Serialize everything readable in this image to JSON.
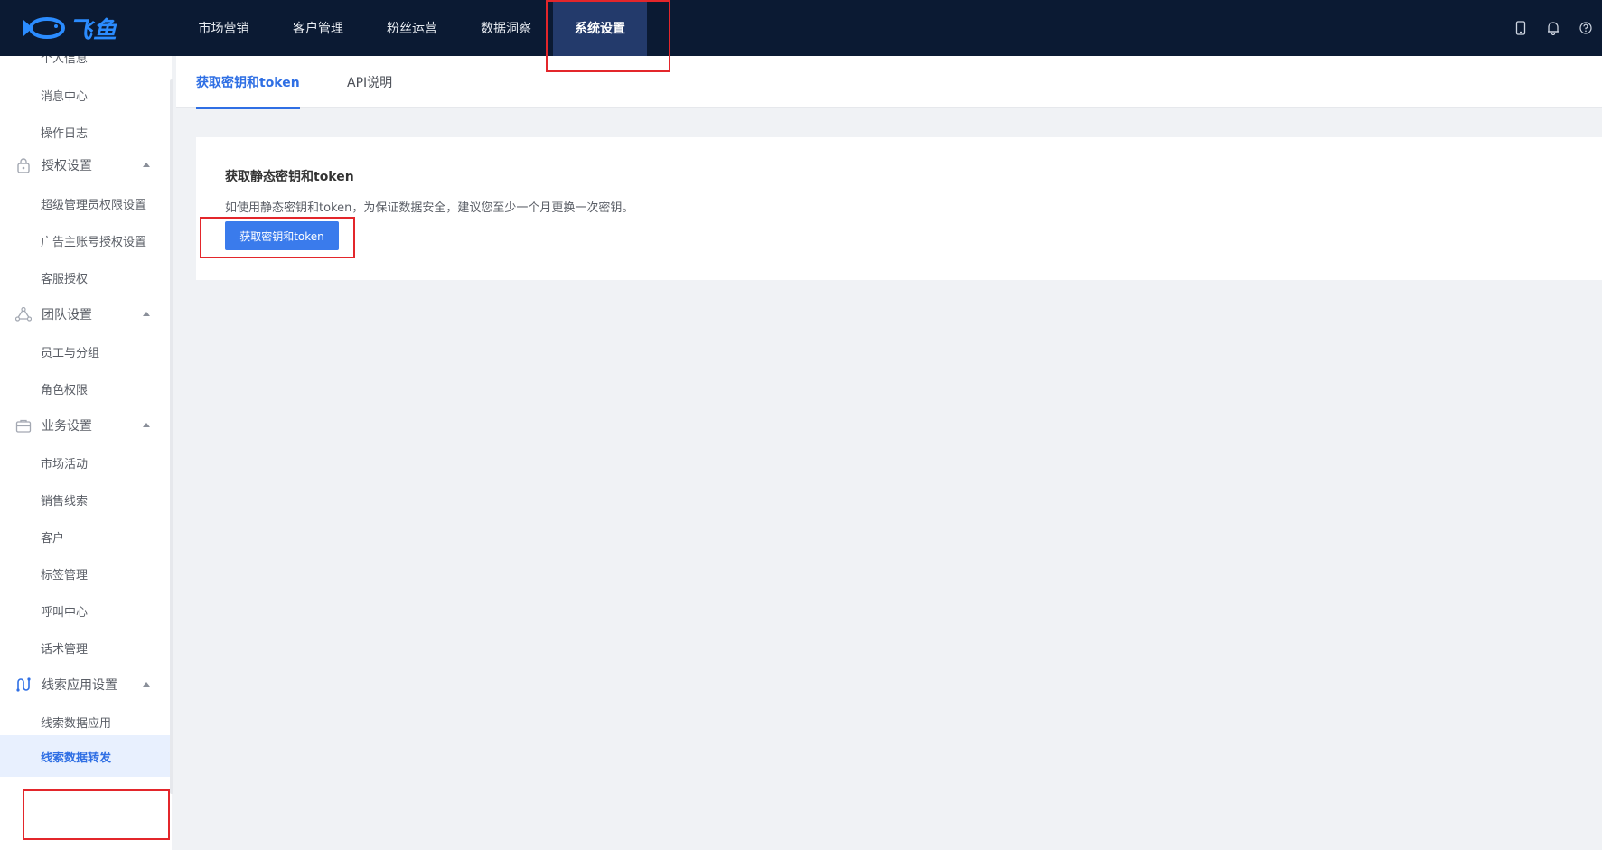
{
  "brand": {
    "logo_text": "飞鱼"
  },
  "topnav": {
    "items": [
      {
        "label": "市场营销"
      },
      {
        "label": "客户管理"
      },
      {
        "label": "粉丝运营"
      },
      {
        "label": "数据洞察"
      },
      {
        "label": "系统设置",
        "active": true
      }
    ],
    "icons": [
      "mobile-icon",
      "bell-icon",
      "help-icon"
    ]
  },
  "sidebar": {
    "partial_top": "个人信息",
    "items_top": [
      "消息中心",
      "操作日志"
    ],
    "groups": [
      {
        "label": "授权设置",
        "icon": "lock-icon",
        "children": [
          "超级管理员权限设置",
          "广告主账号授权设置",
          "客服授权"
        ]
      },
      {
        "label": "团队设置",
        "icon": "team-icon",
        "children": [
          "员工与分组",
          "角色权限"
        ]
      },
      {
        "label": "业务设置",
        "icon": "briefcase-icon",
        "children": [
          "市场活动",
          "销售线索",
          "客户",
          "标签管理",
          "呼叫中心",
          "话术管理"
        ]
      },
      {
        "label": "线索应用设置",
        "icon": "flow-icon",
        "children": [
          "线索数据应用",
          "线索数据转发"
        ]
      }
    ],
    "active_item": "线索数据转发"
  },
  "tabs": [
    {
      "label": "获取密钥和token",
      "active": true
    },
    {
      "label": "API说明",
      "active": false
    }
  ],
  "card": {
    "title": "获取静态密钥和token",
    "description": "如使用静态密钥和token，为保证数据安全，建议您至少一个月更换一次密钥。",
    "button_label": "获取密钥和token"
  },
  "colors": {
    "topbar_bg": "#0b1a33",
    "nav_active_bg": "#233a6b",
    "accent": "#2f6fe4",
    "button_bg": "#3a7bec",
    "annotation_red": "#e3262b"
  }
}
